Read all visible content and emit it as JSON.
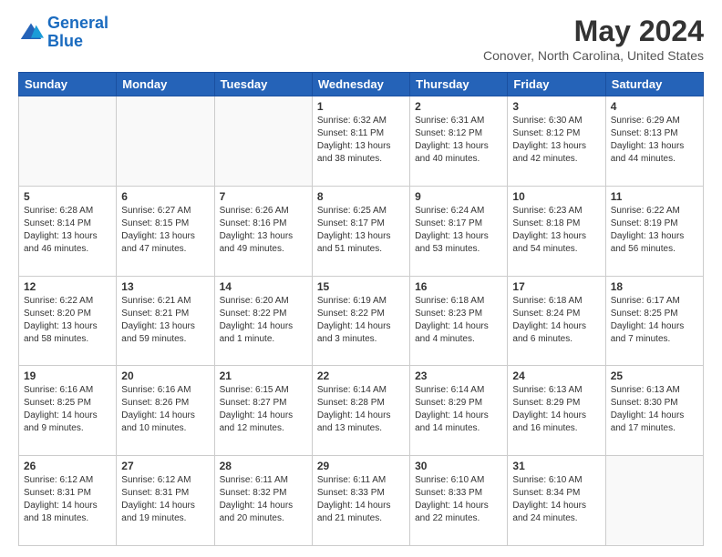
{
  "header": {
    "logo_line1": "General",
    "logo_line2": "Blue",
    "month_title": "May 2024",
    "location": "Conover, North Carolina, United States"
  },
  "days_of_week": [
    "Sunday",
    "Monday",
    "Tuesday",
    "Wednesday",
    "Thursday",
    "Friday",
    "Saturday"
  ],
  "weeks": [
    [
      {
        "day": "",
        "info": ""
      },
      {
        "day": "",
        "info": ""
      },
      {
        "day": "",
        "info": ""
      },
      {
        "day": "1",
        "info": "Sunrise: 6:32 AM\nSunset: 8:11 PM\nDaylight: 13 hours\nand 38 minutes."
      },
      {
        "day": "2",
        "info": "Sunrise: 6:31 AM\nSunset: 8:12 PM\nDaylight: 13 hours\nand 40 minutes."
      },
      {
        "day": "3",
        "info": "Sunrise: 6:30 AM\nSunset: 8:12 PM\nDaylight: 13 hours\nand 42 minutes."
      },
      {
        "day": "4",
        "info": "Sunrise: 6:29 AM\nSunset: 8:13 PM\nDaylight: 13 hours\nand 44 minutes."
      }
    ],
    [
      {
        "day": "5",
        "info": "Sunrise: 6:28 AM\nSunset: 8:14 PM\nDaylight: 13 hours\nand 46 minutes."
      },
      {
        "day": "6",
        "info": "Sunrise: 6:27 AM\nSunset: 8:15 PM\nDaylight: 13 hours\nand 47 minutes."
      },
      {
        "day": "7",
        "info": "Sunrise: 6:26 AM\nSunset: 8:16 PM\nDaylight: 13 hours\nand 49 minutes."
      },
      {
        "day": "8",
        "info": "Sunrise: 6:25 AM\nSunset: 8:17 PM\nDaylight: 13 hours\nand 51 minutes."
      },
      {
        "day": "9",
        "info": "Sunrise: 6:24 AM\nSunset: 8:17 PM\nDaylight: 13 hours\nand 53 minutes."
      },
      {
        "day": "10",
        "info": "Sunrise: 6:23 AM\nSunset: 8:18 PM\nDaylight: 13 hours\nand 54 minutes."
      },
      {
        "day": "11",
        "info": "Sunrise: 6:22 AM\nSunset: 8:19 PM\nDaylight: 13 hours\nand 56 minutes."
      }
    ],
    [
      {
        "day": "12",
        "info": "Sunrise: 6:22 AM\nSunset: 8:20 PM\nDaylight: 13 hours\nand 58 minutes."
      },
      {
        "day": "13",
        "info": "Sunrise: 6:21 AM\nSunset: 8:21 PM\nDaylight: 13 hours\nand 59 minutes."
      },
      {
        "day": "14",
        "info": "Sunrise: 6:20 AM\nSunset: 8:22 PM\nDaylight: 14 hours\nand 1 minute."
      },
      {
        "day": "15",
        "info": "Sunrise: 6:19 AM\nSunset: 8:22 PM\nDaylight: 14 hours\nand 3 minutes."
      },
      {
        "day": "16",
        "info": "Sunrise: 6:18 AM\nSunset: 8:23 PM\nDaylight: 14 hours\nand 4 minutes."
      },
      {
        "day": "17",
        "info": "Sunrise: 6:18 AM\nSunset: 8:24 PM\nDaylight: 14 hours\nand 6 minutes."
      },
      {
        "day": "18",
        "info": "Sunrise: 6:17 AM\nSunset: 8:25 PM\nDaylight: 14 hours\nand 7 minutes."
      }
    ],
    [
      {
        "day": "19",
        "info": "Sunrise: 6:16 AM\nSunset: 8:25 PM\nDaylight: 14 hours\nand 9 minutes."
      },
      {
        "day": "20",
        "info": "Sunrise: 6:16 AM\nSunset: 8:26 PM\nDaylight: 14 hours\nand 10 minutes."
      },
      {
        "day": "21",
        "info": "Sunrise: 6:15 AM\nSunset: 8:27 PM\nDaylight: 14 hours\nand 12 minutes."
      },
      {
        "day": "22",
        "info": "Sunrise: 6:14 AM\nSunset: 8:28 PM\nDaylight: 14 hours\nand 13 minutes."
      },
      {
        "day": "23",
        "info": "Sunrise: 6:14 AM\nSunset: 8:29 PM\nDaylight: 14 hours\nand 14 minutes."
      },
      {
        "day": "24",
        "info": "Sunrise: 6:13 AM\nSunset: 8:29 PM\nDaylight: 14 hours\nand 16 minutes."
      },
      {
        "day": "25",
        "info": "Sunrise: 6:13 AM\nSunset: 8:30 PM\nDaylight: 14 hours\nand 17 minutes."
      }
    ],
    [
      {
        "day": "26",
        "info": "Sunrise: 6:12 AM\nSunset: 8:31 PM\nDaylight: 14 hours\nand 18 minutes."
      },
      {
        "day": "27",
        "info": "Sunrise: 6:12 AM\nSunset: 8:31 PM\nDaylight: 14 hours\nand 19 minutes."
      },
      {
        "day": "28",
        "info": "Sunrise: 6:11 AM\nSunset: 8:32 PM\nDaylight: 14 hours\nand 20 minutes."
      },
      {
        "day": "29",
        "info": "Sunrise: 6:11 AM\nSunset: 8:33 PM\nDaylight: 14 hours\nand 21 minutes."
      },
      {
        "day": "30",
        "info": "Sunrise: 6:10 AM\nSunset: 8:33 PM\nDaylight: 14 hours\nand 22 minutes."
      },
      {
        "day": "31",
        "info": "Sunrise: 6:10 AM\nSunset: 8:34 PM\nDaylight: 14 hours\nand 24 minutes."
      },
      {
        "day": "",
        "info": ""
      }
    ]
  ]
}
